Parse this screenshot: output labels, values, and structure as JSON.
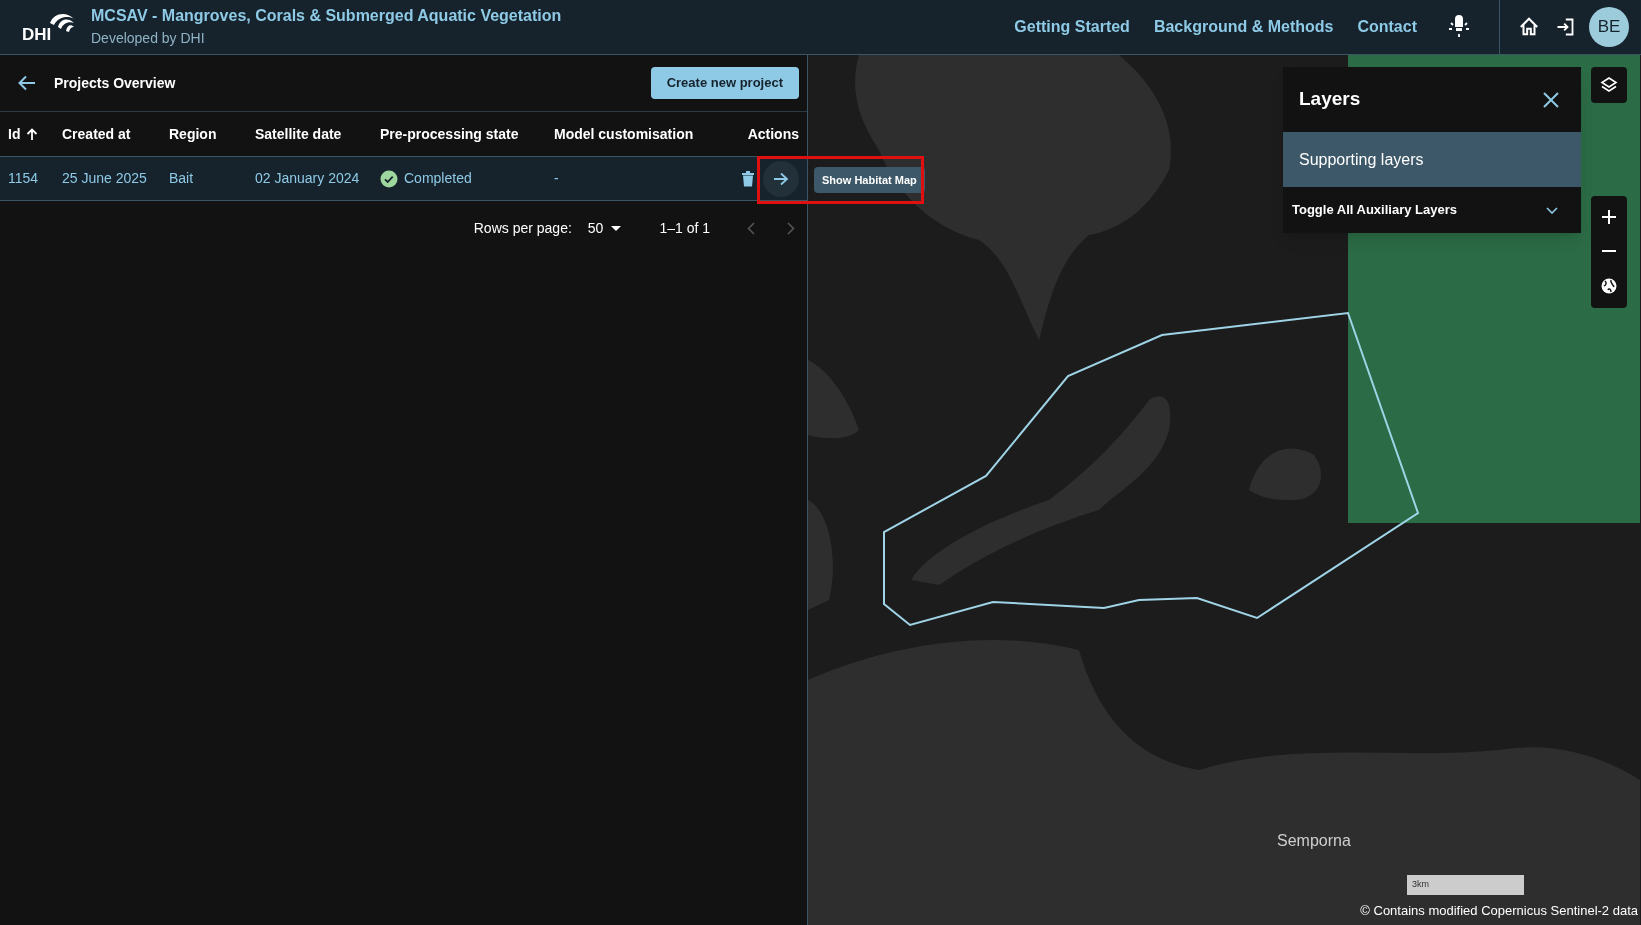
{
  "header": {
    "logo": "DHI",
    "title": "MCSAV - Mangroves, Corals & Submerged Aquatic Vegetation",
    "subtitle": "Developed by DHI",
    "nav": [
      "Getting Started",
      "Background & Methods",
      "Contact"
    ],
    "avatar": "BE"
  },
  "projects": {
    "title": "Projects Overview",
    "create_button": "Create new project",
    "columns": [
      {
        "label": "Id",
        "sorted": true
      },
      {
        "label": "Created at",
        "sorted": false
      },
      {
        "label": "Region",
        "sorted": false
      },
      {
        "label": "Satellite date",
        "sorted": false
      },
      {
        "label": "Pre-processing state",
        "sorted": false
      },
      {
        "label": "Model customisation",
        "sorted": false
      },
      {
        "label": "Actions",
        "sorted": false
      }
    ],
    "rows": [
      {
        "id": "1154",
        "created_at": "25 June 2025",
        "region": "Bait",
        "satellite_date": "02 January 2024",
        "state": "Completed",
        "completed": true,
        "model": "-",
        "hovered": true
      }
    ],
    "tooltip": "Show Habitat Map",
    "pagination": {
      "rows_per_page_label": "Rows per page:",
      "rows_per_page": "50",
      "range": "1–1 of 1"
    }
  },
  "layers": {
    "title": "Layers",
    "section": "Supporting layers",
    "toggle": "Toggle All Auxiliary Layers",
    "expanded": false
  },
  "map": {
    "place_label": "Semporna",
    "scale": "3km",
    "attribution": "© Contains modified Copernicus Sentinel-2 data"
  }
}
